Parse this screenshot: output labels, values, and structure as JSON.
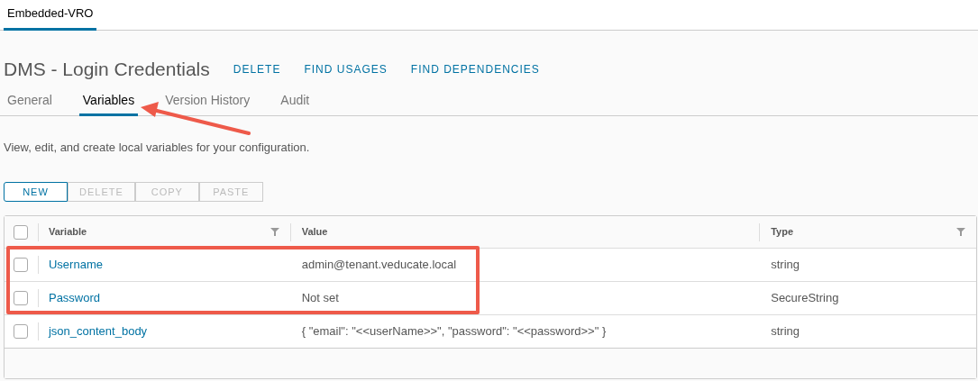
{
  "top_tabs": [
    {
      "label": "Embedded-VRO",
      "selected": true
    }
  ],
  "header": {
    "title": "DMS - Login Credentials",
    "actions": [
      "DELETE",
      "FIND USAGES",
      "FIND DEPENDENCIES"
    ]
  },
  "tabs": [
    {
      "label": "General",
      "selected": false
    },
    {
      "label": "Variables",
      "selected": true
    },
    {
      "label": "Version History",
      "selected": false
    },
    {
      "label": "Audit",
      "selected": false
    }
  ],
  "description": "View, edit, and create local variables for your configuration.",
  "toolbar": [
    {
      "label": "NEW",
      "disabled": false
    },
    {
      "label": "DELETE",
      "disabled": true
    },
    {
      "label": "COPY",
      "disabled": true
    },
    {
      "label": "PASTE",
      "disabled": true
    }
  ],
  "table": {
    "select_all_checked": false,
    "columns": [
      {
        "label": "Variable",
        "filterable": true
      },
      {
        "label": "Value",
        "filterable": false
      },
      {
        "label": "Type",
        "filterable": true
      }
    ],
    "rows": [
      {
        "checked": false,
        "variable": "Username",
        "value": "admin@tenant.veducate.local",
        "type": "string"
      },
      {
        "checked": false,
        "variable": "Password",
        "value": "Not set",
        "type": "SecureString"
      },
      {
        "checked": false,
        "variable": "json_content_body",
        "value": "{ \"email\": \"<<userName>>\", \"password\": \"<<password>>\" }",
        "type": "string"
      }
    ]
  }
}
